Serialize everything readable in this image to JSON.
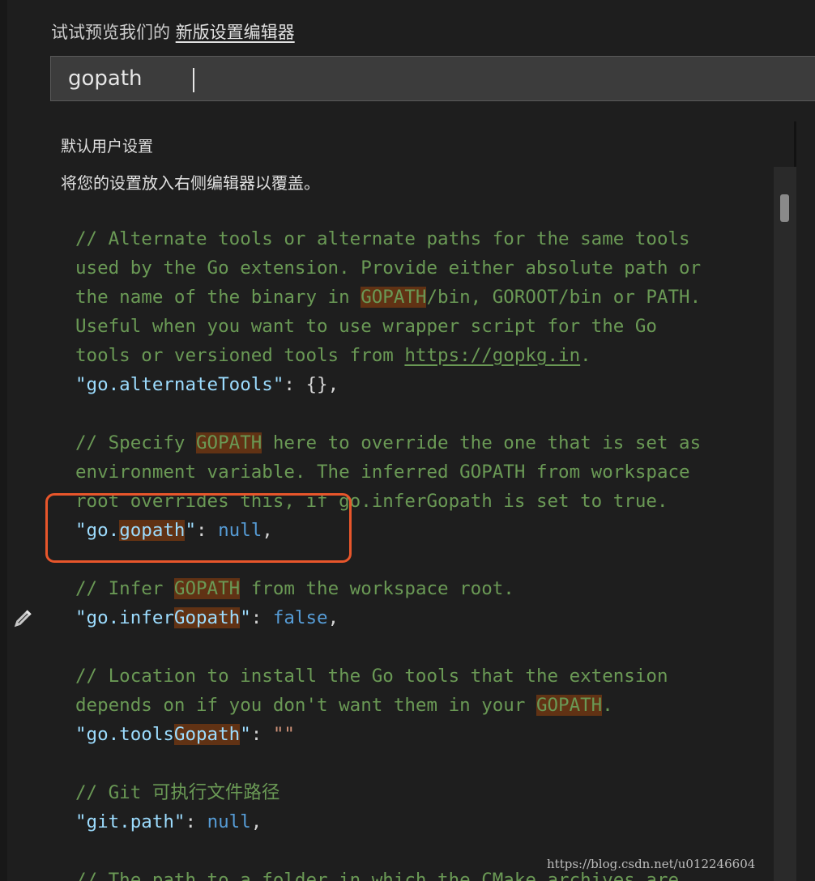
{
  "header": {
    "prefix": "试试预览我们的 ",
    "link": "新版设置编辑器"
  },
  "search": {
    "value": "gopath"
  },
  "settings": {
    "title": "默认用户设置",
    "subtitle": "将您的设置放入右侧编辑器以覆盖。"
  },
  "code": {
    "lines": [
      [
        {
          "t": "// Alternate tools or alternate paths for the same tools",
          "c": "cmt"
        }
      ],
      [
        {
          "t": "used by the Go extension. Provide either absolute path or",
          "c": "cmt"
        }
      ],
      [
        {
          "t": "the name of the binary in ",
          "c": "cmt"
        },
        {
          "t": "GOPATH",
          "c": "cmt hl"
        },
        {
          "t": "/bin, GOROOT/bin or PATH.",
          "c": "cmt"
        }
      ],
      [
        {
          "t": "Useful when you want to use wrapper script for the Go",
          "c": "cmt"
        }
      ],
      [
        {
          "t": "tools or versioned tools from ",
          "c": "cmt"
        },
        {
          "t": "https://gopkg.in",
          "c": "cmt url"
        },
        {
          "t": ".",
          "c": "cmt"
        }
      ],
      [
        {
          "t": "\"go.alternateTools\"",
          "c": "key"
        },
        {
          "t": ": {},",
          "c": "punc"
        }
      ],
      [],
      [
        {
          "t": "// Specify ",
          "c": "cmt"
        },
        {
          "t": "GOPATH",
          "c": "cmt hl"
        },
        {
          "t": " here to override the one that is set as",
          "c": "cmt"
        }
      ],
      [
        {
          "t": "environment variable. The inferred GOPATH from workspace",
          "c": "cmt"
        }
      ],
      [
        {
          "t": "root overrides this, if go.inferGopath is set to true.",
          "c": "cmt"
        }
      ],
      [
        {
          "t": "\"go.",
          "c": "key"
        },
        {
          "t": "gopath",
          "c": "key hl"
        },
        {
          "t": "\"",
          "c": "key"
        },
        {
          "t": ": ",
          "c": "punc"
        },
        {
          "t": "null",
          "c": "kw"
        },
        {
          "t": ",",
          "c": "punc"
        }
      ],
      [],
      [
        {
          "t": "// Infer ",
          "c": "cmt"
        },
        {
          "t": "GOPATH",
          "c": "cmt hl"
        },
        {
          "t": " from the workspace root.",
          "c": "cmt"
        }
      ],
      [
        {
          "t": "\"go.infer",
          "c": "key"
        },
        {
          "t": "Gopath",
          "c": "key hl"
        },
        {
          "t": "\"",
          "c": "key"
        },
        {
          "t": ": ",
          "c": "punc"
        },
        {
          "t": "false",
          "c": "kw"
        },
        {
          "t": ",",
          "c": "punc"
        }
      ],
      [],
      [
        {
          "t": "// Location to install the Go tools that the extension",
          "c": "cmt"
        }
      ],
      [
        {
          "t": "depends on if you don't want them in your ",
          "c": "cmt"
        },
        {
          "t": "GOPATH",
          "c": "cmt hl"
        },
        {
          "t": ".",
          "c": "cmt"
        }
      ],
      [
        {
          "t": "\"go.tools",
          "c": "key"
        },
        {
          "t": "Gopath",
          "c": "key hl"
        },
        {
          "t": "\"",
          "c": "key"
        },
        {
          "t": ": ",
          "c": "punc"
        },
        {
          "t": "\"\"",
          "c": "str"
        }
      ],
      [],
      [
        {
          "t": "// Git 可执行文件路径",
          "c": "cmt"
        }
      ],
      [
        {
          "t": "\"git.path\"",
          "c": "key"
        },
        {
          "t": ": ",
          "c": "punc"
        },
        {
          "t": "null",
          "c": "kw"
        },
        {
          "t": ",",
          "c": "punc"
        }
      ],
      [],
      [
        {
          "t": "// The path to a folder in which the CMake archives are",
          "c": "cmt"
        }
      ]
    ]
  },
  "icons": {
    "edit": "pencil-icon"
  },
  "colors": {
    "background": "#1e1e1e",
    "comment": "#6a9955",
    "key": "#9cdcfe",
    "keyword": "#569cd6",
    "string": "#ce9178",
    "match_highlight": "#613214",
    "annotation": "#e8562b"
  },
  "watermark": "https://blog.csdn.net/u012246604"
}
